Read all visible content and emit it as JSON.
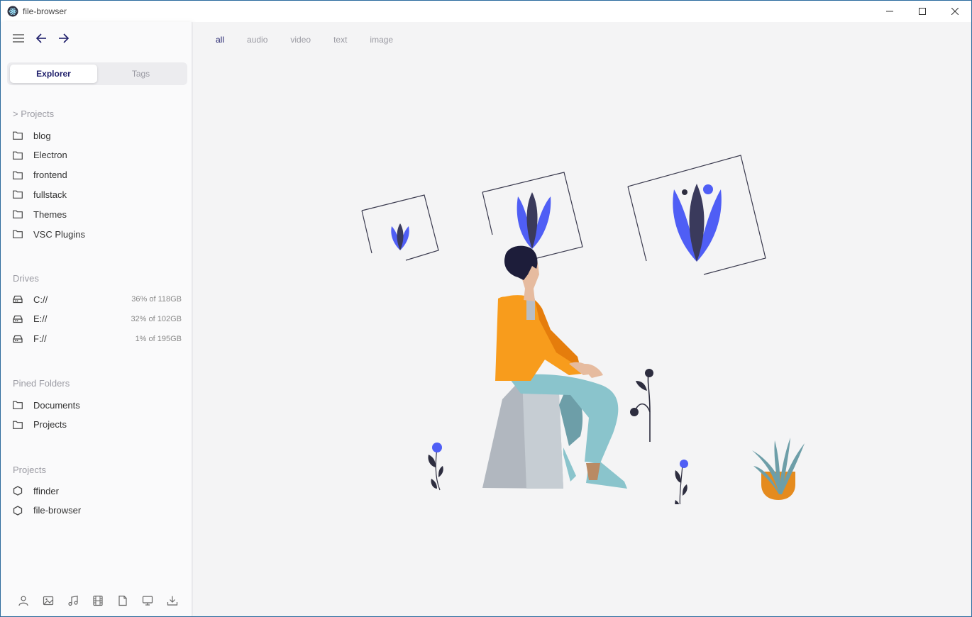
{
  "window": {
    "title": "file-browser"
  },
  "tabs": {
    "explorer": "Explorer",
    "tags": "Tags"
  },
  "projects_section": {
    "title": "> Projects",
    "items": [
      "blog",
      "Electron",
      "frontend",
      "fullstack",
      "Themes",
      "VSC Plugins"
    ]
  },
  "drives_section": {
    "title": "Drives",
    "items": [
      {
        "label": "C://",
        "usage": "36% of 118GB"
      },
      {
        "label": "E://",
        "usage": "32% of 102GB"
      },
      {
        "label": "F://",
        "usage": "1% of 195GB"
      }
    ]
  },
  "pinned_section": {
    "title": "Pined Folders",
    "items": [
      "Documents",
      "Projects"
    ]
  },
  "workspaces_section": {
    "title": "Projects",
    "items": [
      "ffinder",
      "file-browser"
    ]
  },
  "filters": [
    "all",
    "audio",
    "video",
    "text",
    "image"
  ],
  "active_filter": "all",
  "bottom_icons": [
    "user-icon",
    "image-icon",
    "music-icon",
    "film-icon",
    "file-icon",
    "monitor-icon",
    "download-icon"
  ],
  "colors": {
    "accent": "#1f1f6b",
    "illustration_blue": "#4f5ef5",
    "illustration_orange": "#f89c1c",
    "border": "#2b6b9e"
  }
}
